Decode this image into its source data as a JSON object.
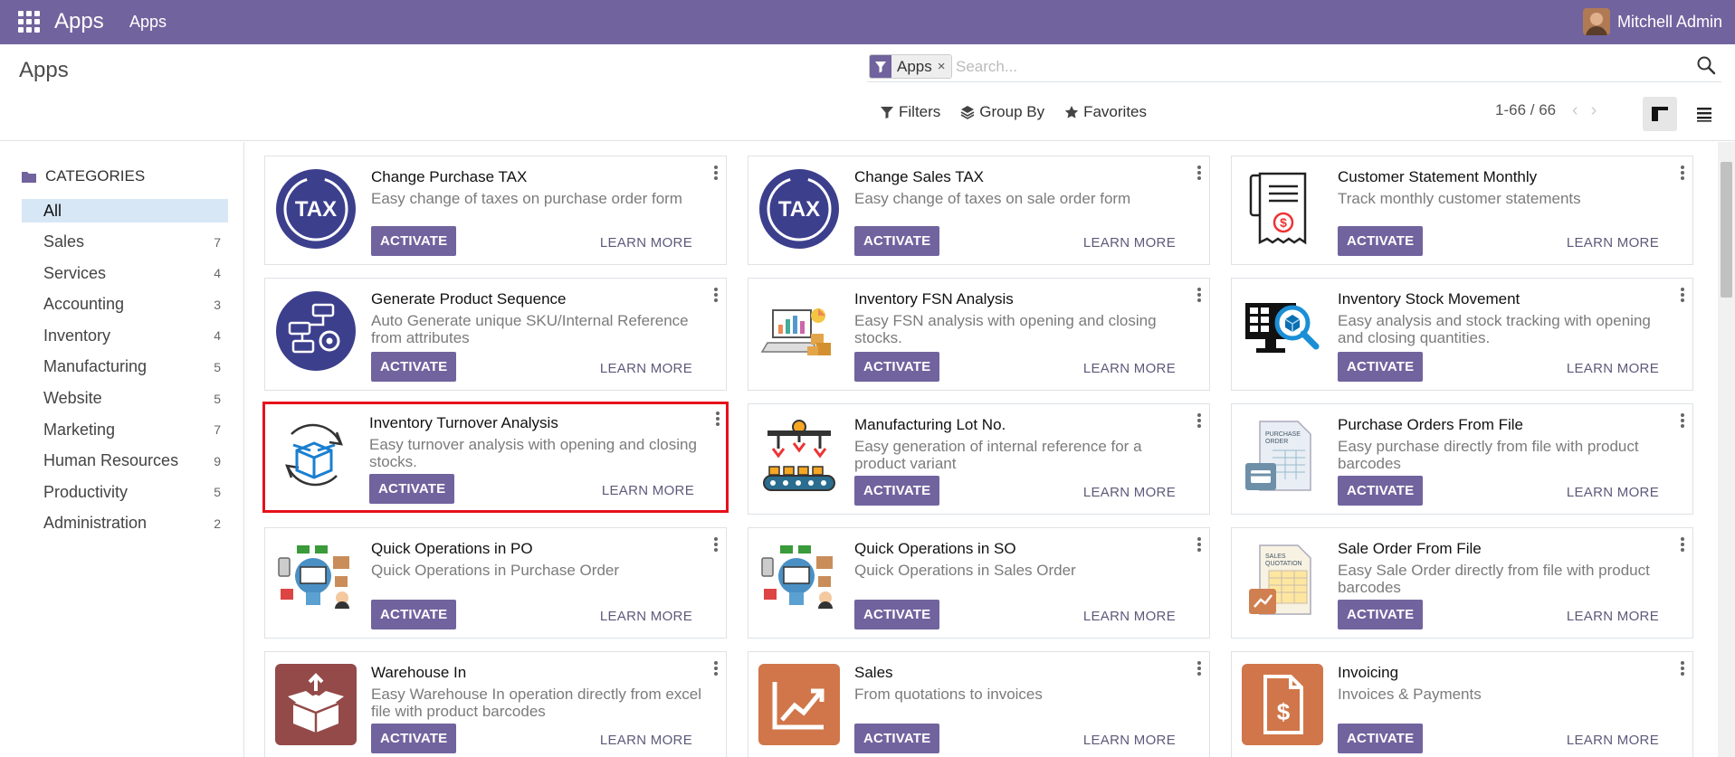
{
  "navbar": {
    "brand": "Apps",
    "menu": "Apps",
    "user": "Mitchell Admin"
  },
  "control": {
    "title": "Apps",
    "facet": "Apps",
    "facet_remove": "×",
    "search_placeholder": "Search...",
    "filters": "Filters",
    "group_by": "Group By",
    "favorites": "Favorites",
    "pager": "1-66 / 66",
    "prev": "‹",
    "next": "›"
  },
  "sidebar": {
    "heading": "CATEGORIES",
    "items": [
      {
        "label": "All",
        "count": ""
      },
      {
        "label": "Sales",
        "count": "7"
      },
      {
        "label": "Services",
        "count": "4"
      },
      {
        "label": "Accounting",
        "count": "3"
      },
      {
        "label": "Inventory",
        "count": "4"
      },
      {
        "label": "Manufacturing",
        "count": "5"
      },
      {
        "label": "Website",
        "count": "5"
      },
      {
        "label": "Marketing",
        "count": "7"
      },
      {
        "label": "Human Resources",
        "count": "9"
      },
      {
        "label": "Productivity",
        "count": "5"
      },
      {
        "label": "Administration",
        "count": "2"
      }
    ]
  },
  "buttons": {
    "activate": "ACTIVATE",
    "learn_more": "LEARN MORE"
  },
  "apps": [
    {
      "title": "Change Purchase TAX",
      "desc": "Easy change of taxes on purchase order form",
      "icon": "tax-icon"
    },
    {
      "title": "Change Sales TAX",
      "desc": "Easy change of taxes on sale order form",
      "icon": "tax-icon"
    },
    {
      "title": "Customer Statement Monthly",
      "desc": "Track monthly customer statements",
      "icon": "receipt-icon"
    },
    {
      "title": "Generate Product Sequence",
      "desc": "Auto Generate unique SKU/Internal Reference from attributes",
      "icon": "sequence-icon"
    },
    {
      "title": "Inventory FSN Analysis",
      "desc": "Easy FSN analysis with opening and closing stocks.",
      "icon": "analysis-icon"
    },
    {
      "title": "Inventory Stock Movement",
      "desc": "Easy analysis and stock tracking with opening and closing quantities.",
      "icon": "stock-search-icon"
    },
    {
      "title": "Inventory Turnover Analysis",
      "desc": "Easy turnover analysis with opening and closing stocks.",
      "icon": "box-cycle-icon"
    },
    {
      "title": "Manufacturing Lot No.",
      "desc": "Easy generation of internal reference for a product variant",
      "icon": "conveyor-icon"
    },
    {
      "title": "Purchase Orders From File",
      "desc": "Easy purchase directly from file with product barcodes",
      "icon": "purchase-file-icon"
    },
    {
      "title": "Quick Operations in PO",
      "desc": "Quick Operations in Purchase Order",
      "icon": "operations-icon"
    },
    {
      "title": "Quick Operations in SO",
      "desc": "Quick Operations in Sales Order",
      "icon": "operations-icon"
    },
    {
      "title": "Sale Order From File",
      "desc": "Easy Sale Order directly from file with product barcodes",
      "icon": "sale-file-icon"
    },
    {
      "title": "Warehouse In",
      "desc": "Easy Warehouse In operation directly from excel file with product barcodes",
      "icon": "warehouse-box-icon"
    },
    {
      "title": "Sales",
      "desc": "From quotations to invoices",
      "icon": "sales-chart-icon"
    },
    {
      "title": "Invoicing",
      "desc": "Invoices & Payments",
      "icon": "invoice-icon"
    }
  ]
}
